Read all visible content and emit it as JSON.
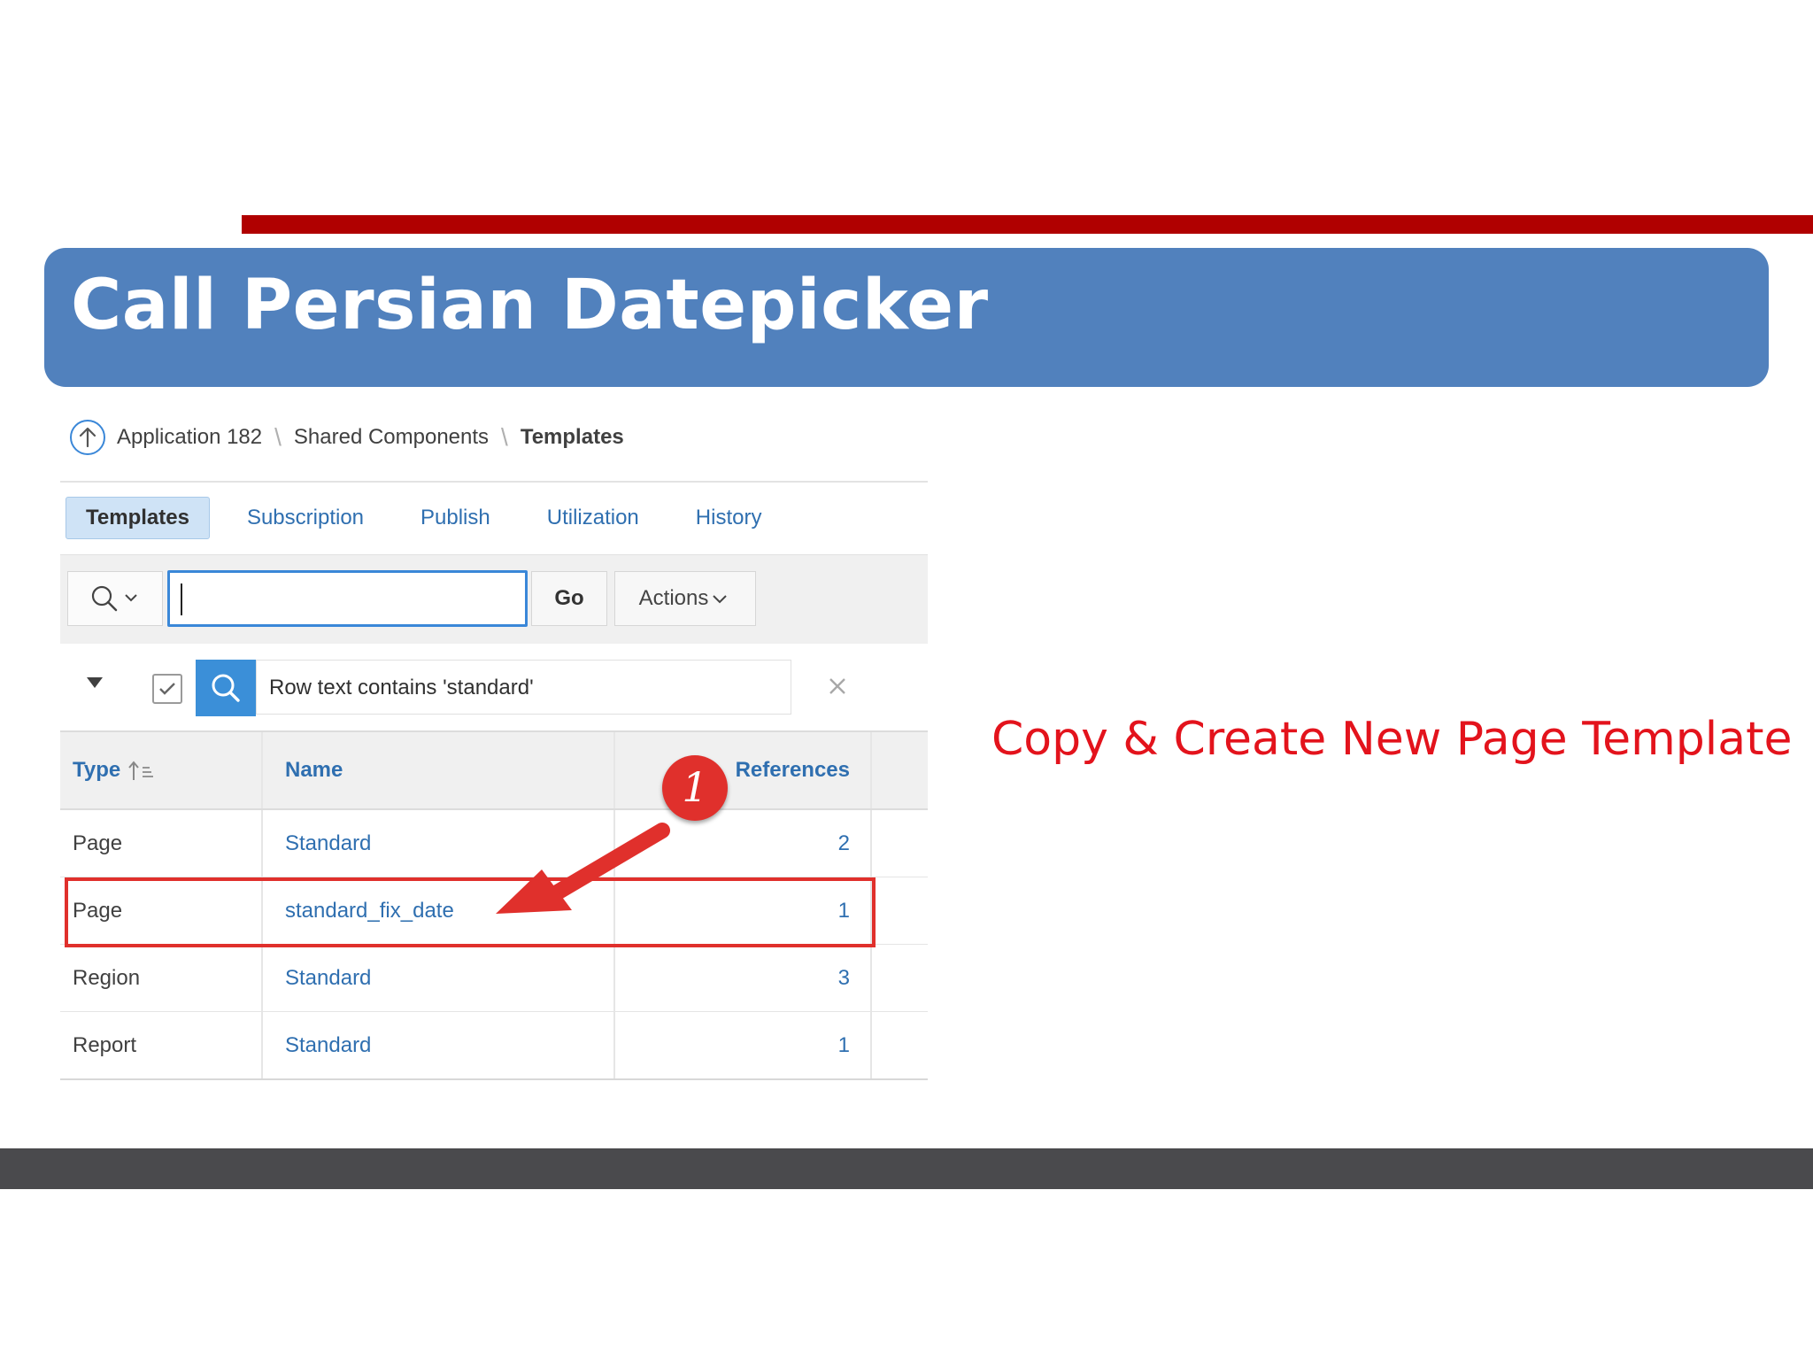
{
  "slide": {
    "title": "Call Persian Datepicker",
    "caption": "Copy & Create New Page Template",
    "colors": {
      "banner": "#5181bd",
      "rule": "#b00000",
      "caption": "#e3131c",
      "footer": "#4a4a4d"
    }
  },
  "breadcrumb": {
    "icon": "up-arrow-circle-icon",
    "items": [
      "Application 182",
      "Shared Components",
      "Templates"
    ],
    "separator": "\\"
  },
  "tabs": [
    {
      "label": "Templates",
      "active": true
    },
    {
      "label": "Subscription",
      "active": false
    },
    {
      "label": "Publish",
      "active": false
    },
    {
      "label": "Utilization",
      "active": false
    },
    {
      "label": "History",
      "active": false
    }
  ],
  "toolbar": {
    "search_value": "",
    "go_label": "Go",
    "actions_label": "Actions"
  },
  "filter": {
    "text": "Row text contains 'standard'",
    "enabled": true
  },
  "table": {
    "columns": [
      "Type",
      "Name",
      "References"
    ],
    "rows": [
      {
        "type": "Page",
        "name": "Standard",
        "references": "2"
      },
      {
        "type": "Page",
        "name": "standard_fix_date",
        "references": "1"
      },
      {
        "type": "Region",
        "name": "Standard",
        "references": "3"
      },
      {
        "type": "Report",
        "name": "Standard",
        "references": "1"
      }
    ]
  },
  "annotation": {
    "step_number": "1",
    "color": "#e0302c"
  }
}
